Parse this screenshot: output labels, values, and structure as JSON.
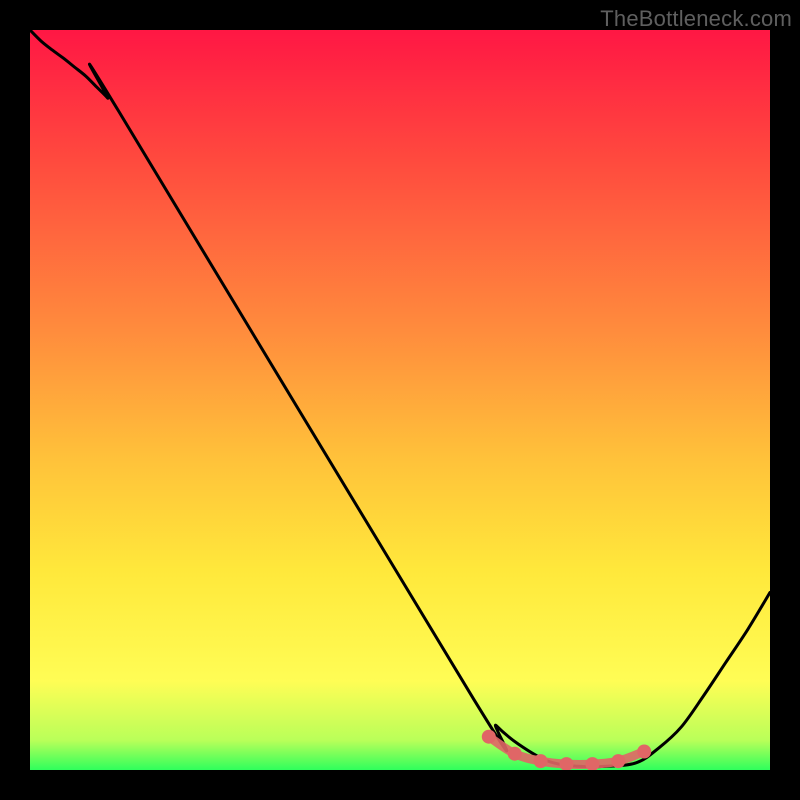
{
  "watermark": "TheBottleneck.com",
  "chart_data": {
    "type": "line",
    "xlim": [
      0,
      1
    ],
    "ylim": [
      0,
      1
    ],
    "title": "",
    "xlabel": "",
    "ylabel": "",
    "series": [
      {
        "name": "main-curve",
        "color": "#000000",
        "x": [
          0.0,
          0.015,
          0.03,
          0.045,
          0.06,
          0.075,
          0.09,
          0.105,
          0.12,
          0.6,
          0.63,
          0.66,
          0.7,
          0.74,
          0.78,
          0.82,
          0.85,
          0.88,
          0.91,
          0.94,
          0.97,
          1.0
        ],
        "y": [
          1.0,
          0.985,
          0.973,
          0.962,
          0.95,
          0.938,
          0.923,
          0.908,
          0.89,
          0.095,
          0.06,
          0.035,
          0.012,
          0.005,
          0.005,
          0.01,
          0.03,
          0.058,
          0.1,
          0.145,
          0.19,
          0.24
        ]
      },
      {
        "name": "highlight-band",
        "color": "#e06666",
        "x": [
          0.62,
          0.655,
          0.69,
          0.725,
          0.76,
          0.795,
          0.83
        ],
        "y": [
          0.045,
          0.022,
          0.012,
          0.008,
          0.008,
          0.012,
          0.025
        ]
      }
    ],
    "gradient_stops": [
      {
        "offset": 0.0,
        "color": "#ff1744"
      },
      {
        "offset": 0.18,
        "color": "#ff4b3e"
      },
      {
        "offset": 0.4,
        "color": "#ff8a3d"
      },
      {
        "offset": 0.58,
        "color": "#ffc23a"
      },
      {
        "offset": 0.73,
        "color": "#ffe83b"
      },
      {
        "offset": 0.88,
        "color": "#fffd55"
      },
      {
        "offset": 0.96,
        "color": "#b9ff59"
      },
      {
        "offset": 1.0,
        "color": "#2fff5c"
      }
    ]
  }
}
